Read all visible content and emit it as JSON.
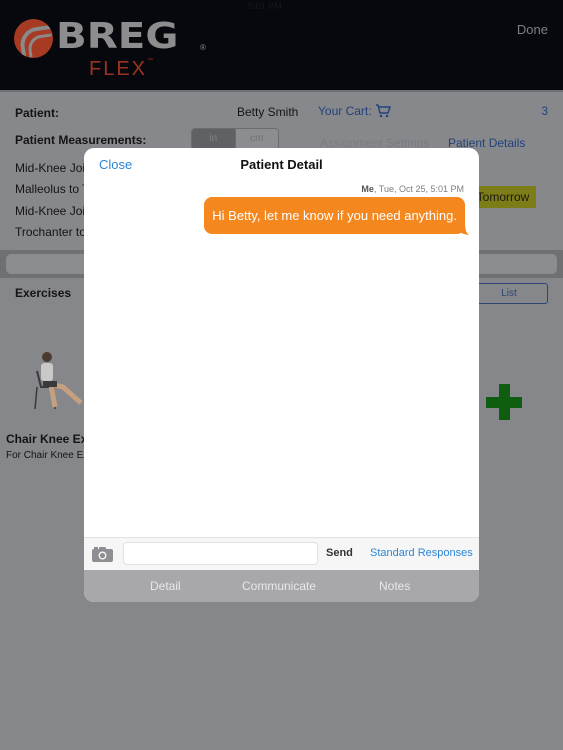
{
  "status_bar": {
    "time": "5:01 PM"
  },
  "header": {
    "brand": "BREG",
    "brand_mark": "®",
    "product": "FLEX",
    "product_mark": "™",
    "done_label": "Done"
  },
  "patient": {
    "patient_label": "Patient:",
    "patient_name": "Betty Smith",
    "measurements_label": "Patient Measurements:",
    "units": [
      "in",
      "cm"
    ],
    "selected_unit": "in",
    "measurement_rows": [
      "Mid-Knee Joir",
      "Malleolus to T",
      "Mid-Knee Joir",
      "Trochanter to"
    ],
    "cart_label": "Your Cart:",
    "cart_count": "3",
    "tabs": [
      "Assignment Settings",
      "Patient Details"
    ],
    "active_tab": "Patient Details",
    "tomorrow_label": "Tomorrow"
  },
  "exercises": {
    "section_label": "Exercises",
    "view_toggle_label": "List",
    "items": [
      {
        "title": "Chair Knee Ex",
        "subtitle": "For Chair Knee Ex"
      }
    ]
  },
  "modal": {
    "title": "Patient Detail",
    "close_label": "Close",
    "messages": [
      {
        "sender": "Me",
        "timestamp": "Tue, Oct 25, 5:01 PM",
        "text": "Hi Betty, let me know if you need anything."
      }
    ],
    "compose": {
      "input_value": "",
      "input_placeholder": "",
      "send_label": "Send",
      "standard_responses_label": "Standard Responses"
    },
    "tabs": [
      "Detail",
      "Communicate",
      "Notes"
    ],
    "active_tab": "Communicate"
  },
  "colors": {
    "bubble": "#f5871f",
    "link": "#2d86d6",
    "brand_red": "#a63a22",
    "add_green": "#0f5e0f"
  }
}
